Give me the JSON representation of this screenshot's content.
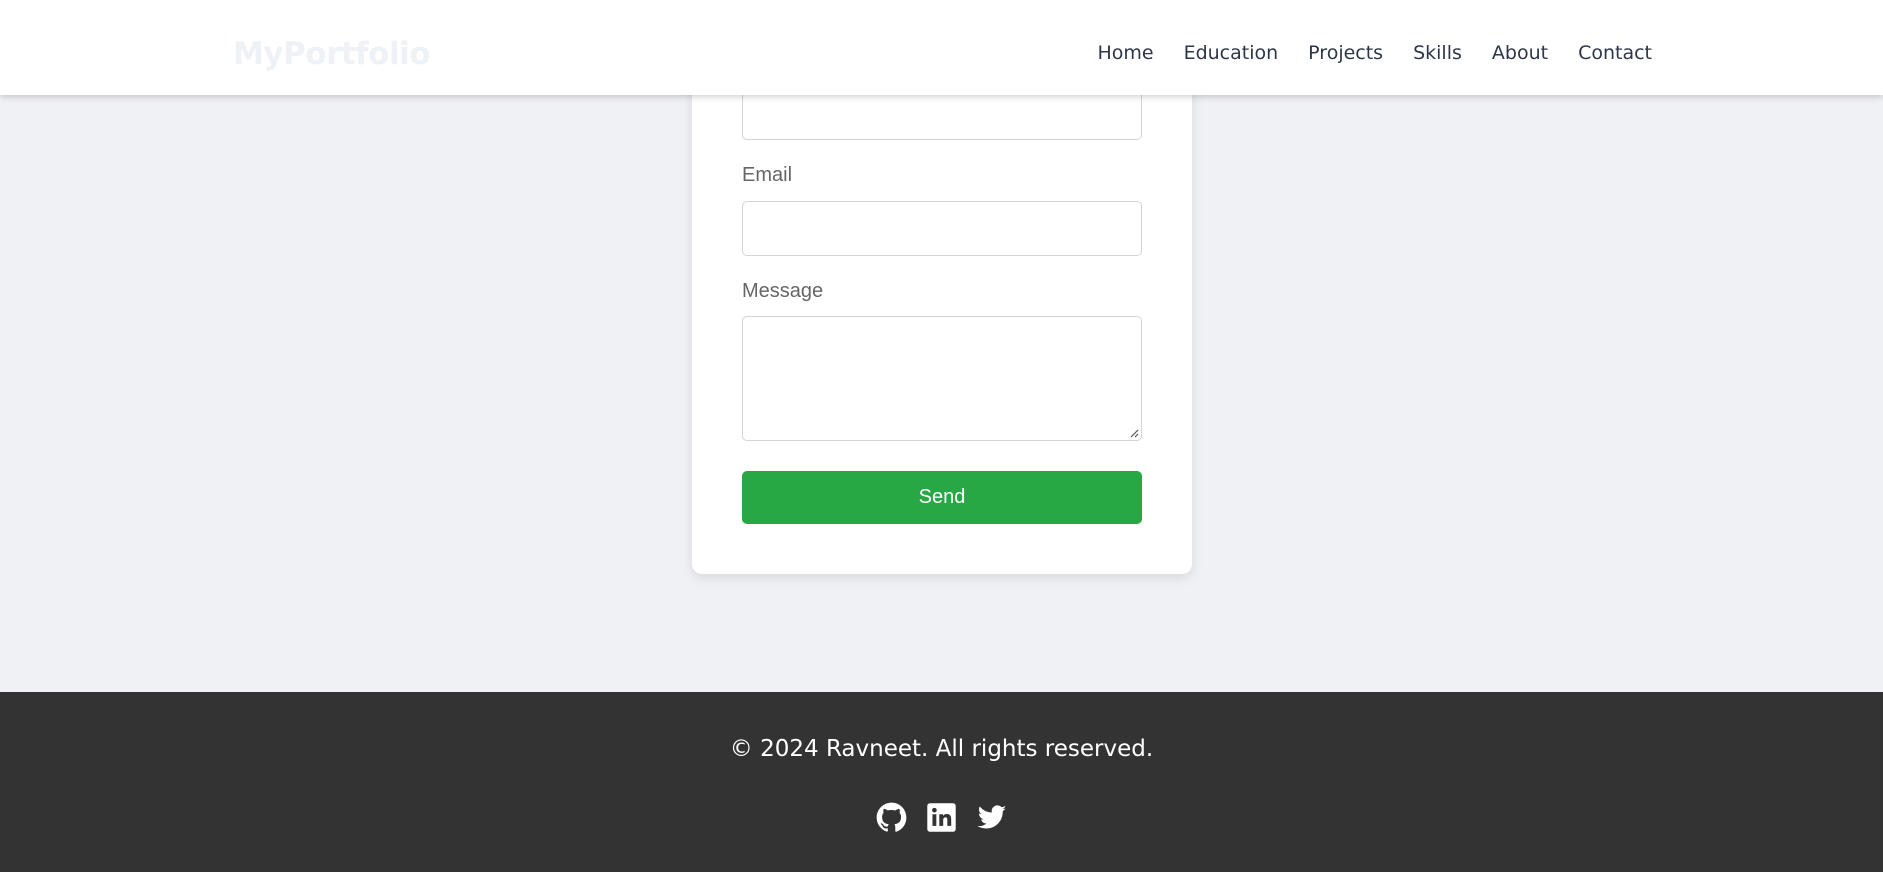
{
  "navbar": {
    "brand": "MyPortfolio",
    "links": [
      "Home",
      "Education",
      "Projects",
      "Skills",
      "About",
      "Contact"
    ]
  },
  "contact_form": {
    "email_label": "Email",
    "message_label": "Message",
    "name_value": "",
    "email_value": "",
    "message_value": "",
    "send_label": "Send"
  },
  "footer": {
    "copyright": "© 2024 Ravneet. All rights reserved.",
    "social": [
      {
        "icon": "github-icon"
      },
      {
        "icon": "linkedin-icon"
      },
      {
        "icon": "twitter-icon"
      }
    ]
  },
  "colors": {
    "page_background": "#f0f1f5",
    "send_button": "#28a745",
    "footer_background": "#333333",
    "nav_text": "#2d3748"
  }
}
